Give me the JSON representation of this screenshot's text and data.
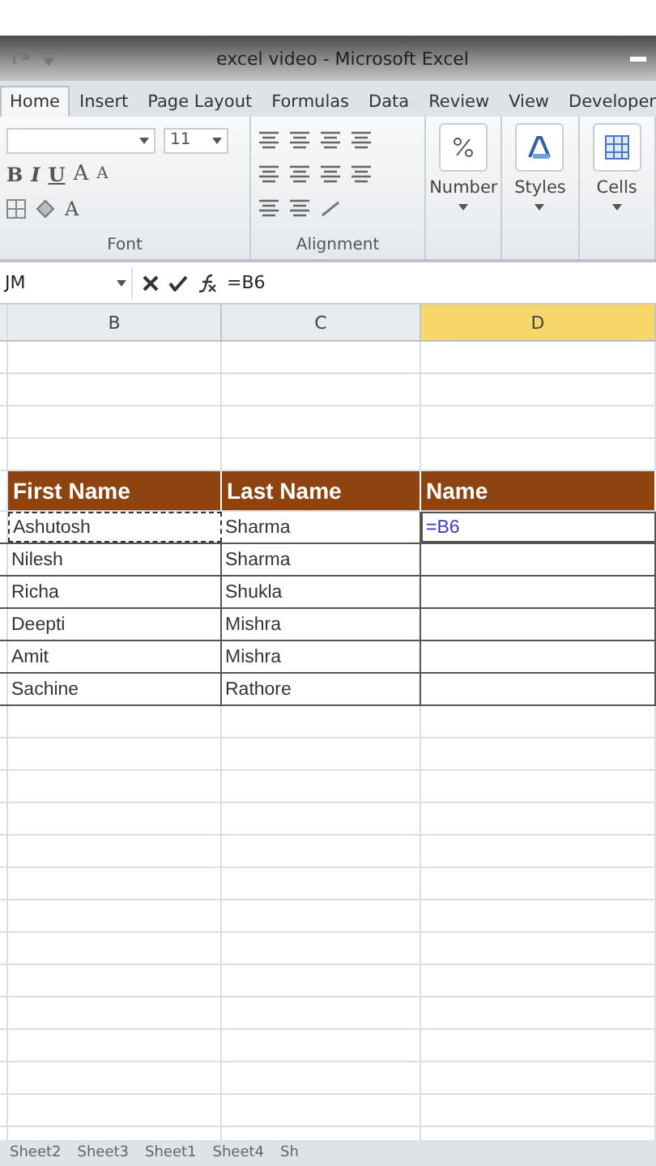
{
  "title_bar": {
    "title": "excel video  -  Microsoft Excel"
  },
  "ribbon_tabs": [
    {
      "label": "Home",
      "selected": true
    },
    {
      "label": "Insert",
      "selected": false
    },
    {
      "label": "Page Layout",
      "selected": false
    },
    {
      "label": "Formulas",
      "selected": false
    },
    {
      "label": "Data",
      "selected": false
    },
    {
      "label": "Review",
      "selected": false
    },
    {
      "label": "View",
      "selected": false
    },
    {
      "label": "Developer",
      "selected": false
    }
  ],
  "ribbon": {
    "font_size": "11",
    "style_buttons": [
      "B",
      "I",
      "U"
    ],
    "size_buttons": [
      "A",
      "A"
    ],
    "font_color": "A",
    "groups": [
      "Font",
      "Alignment"
    ],
    "big_buttons": [
      "Number",
      "Styles",
      "Cells"
    ]
  },
  "formula_bar": {
    "name_box": "JM",
    "formula": "=B6"
  },
  "columns": [
    {
      "label": "B",
      "selected": false
    },
    {
      "label": "C",
      "selected": false
    },
    {
      "label": "D",
      "selected": true
    }
  ],
  "table": {
    "headers": [
      "First Name",
      "Last Name",
      "Name"
    ],
    "rows": [
      {
        "cells": [
          {
            "text": "Ashutosh",
            "copied": true,
            "editing": false
          },
          {
            "text": "Sharma",
            "copied": false,
            "editing": false
          },
          {
            "text": "=B6",
            "copied": false,
            "editing": true
          }
        ]
      },
      {
        "cells": [
          {
            "text": "Nilesh",
            "copied": false,
            "editing": false
          },
          {
            "text": "Sharma",
            "copied": false,
            "editing": false
          }
        ]
      },
      {
        "cells": [
          {
            "text": "Richa",
            "copied": false,
            "editing": false
          },
          {
            "text": "Shukla",
            "copied": false,
            "editing": false
          }
        ]
      },
      {
        "cells": [
          {
            "text": "Deepti",
            "copied": false,
            "editing": false
          },
          {
            "text": "Mishra",
            "copied": false,
            "editing": false
          }
        ]
      },
      {
        "cells": [
          {
            "text": "Amit",
            "copied": false,
            "editing": false
          },
          {
            "text": "Mishra",
            "copied": false,
            "editing": false
          }
        ]
      },
      {
        "cells": [
          {
            "text": "Sachine",
            "copied": false,
            "editing": false
          },
          {
            "text": "Rathore",
            "copied": false,
            "editing": false
          }
        ]
      }
    ]
  },
  "sheet_tabs": [
    "Sheet2",
    "Sheet3",
    "Sheet1",
    "Sheet4",
    "Sh"
  ]
}
